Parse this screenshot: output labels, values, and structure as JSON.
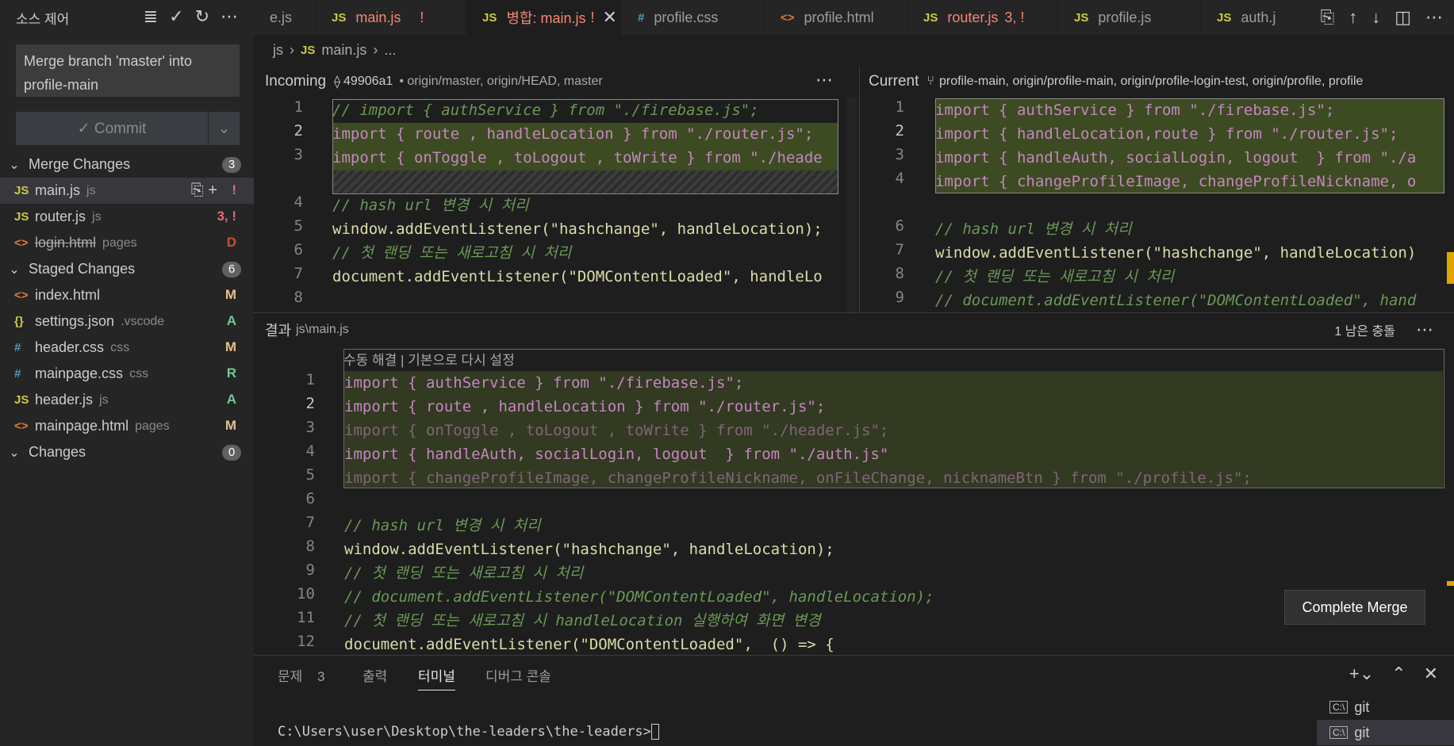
{
  "sidebar": {
    "title": "소스 제어",
    "commit_message": "Merge branch 'master' into profile-main",
    "commit_label": "✓ Commit",
    "merge_changes": {
      "label": "Merge Changes",
      "count": "3"
    },
    "staged_changes": {
      "label": "Staged Changes",
      "count": "6"
    },
    "changes": {
      "label": "Changes",
      "count": "0"
    },
    "merge_items": [
      {
        "icon": "JS",
        "name": "main.js",
        "dir": "js",
        "status": "!"
      },
      {
        "icon": "JS",
        "name": "router.js",
        "dir": "js",
        "status": "3, !"
      },
      {
        "icon": "<>",
        "name": "login.html",
        "dir": "pages",
        "status": "D"
      }
    ],
    "staged_items": [
      {
        "icon": "<>",
        "name": "index.html",
        "dir": "",
        "status": "M"
      },
      {
        "icon": "{}",
        "name": "settings.json",
        "dir": ".vscode",
        "status": "A"
      },
      {
        "icon": "#",
        "name": "header.css",
        "dir": "css",
        "status": "M"
      },
      {
        "icon": "#",
        "name": "mainpage.css",
        "dir": "css",
        "status": "R"
      },
      {
        "icon": "JS",
        "name": "header.js",
        "dir": "js",
        "status": "A"
      },
      {
        "icon": "<>",
        "name": "mainpage.html",
        "dir": "pages",
        "status": "M"
      }
    ]
  },
  "tabs": [
    {
      "icon": "",
      "name": "e.js",
      "badge": ""
    },
    {
      "icon": "JS",
      "name": "main.js",
      "badge": "!"
    },
    {
      "icon": "JS",
      "name": "병합: main.js",
      "badge": "!"
    },
    {
      "icon": "#",
      "name": "profile.css",
      "badge": ""
    },
    {
      "icon": "<>",
      "name": "profile.html",
      "badge": ""
    },
    {
      "icon": "JS",
      "name": "router.js",
      "badge": "3, !"
    },
    {
      "icon": "JS",
      "name": "profile.js",
      "badge": ""
    },
    {
      "icon": "JS",
      "name": "auth.j",
      "badge": ""
    }
  ],
  "breadcrumb": {
    "folder": "js",
    "file": "main.js",
    "more": "..."
  },
  "incoming": {
    "label": "Incoming",
    "commit": "49906a1",
    "refs": "• origin/master, origin/HEAD, master"
  },
  "current": {
    "label": "Current",
    "refs": "profile-main, origin/profile-main, origin/profile-login-test, origin/profile, profile"
  },
  "result": {
    "label": "결과",
    "path": "js\\main.js",
    "conflicts": "1 남은 충돌",
    "codelens": "수동 해결 | 기본으로 다시 설정"
  },
  "complete_merge": "Complete Merge",
  "panel": {
    "tabs": [
      "문제",
      "출력",
      "터미널",
      "디버그 콘솔"
    ],
    "problems_count": "3",
    "prompt": "C:\\Users\\user\\Desktop\\the-leaders\\the-leaders>",
    "terminals": [
      "git",
      "git"
    ]
  },
  "line_numbers": {
    "incoming": [
      "1",
      "2",
      "3",
      "",
      "4",
      "5",
      "6",
      "7",
      "8"
    ],
    "current": [
      "1",
      "2",
      "3",
      "4",
      "",
      "6",
      "7",
      "8",
      "9"
    ],
    "result": [
      "1",
      "2",
      "3",
      "4",
      "5",
      "6",
      "7",
      "8",
      "9",
      "10",
      "11",
      "12"
    ]
  },
  "code": {
    "incoming": [
      "// import { authService } from \"./firebase.js\";",
      "import { route , handleLocation } from \"./router.js\";",
      "import { onToggle , toLogout , toWrite } from \"./heade",
      "",
      "// hash url 변경 시 처리",
      "window.addEventListener(\"hashchange\", handleLocation);",
      "// 첫 랜딩 또는 새로고침 시 처리",
      "document.addEventListener(\"DOMContentLoaded\", handleLo"
    ],
    "current": [
      "import { authService } from \"./firebase.js\";",
      "import { handleLocation,route } from \"./router.js\";",
      "import { handleAuth, socialLogin, logout  } from \"./a",
      "import { changeProfileImage, changeProfileNickname, o",
      "",
      "// hash url 변경 시 처리",
      "window.addEventListener(\"hashchange\", handleLocation)",
      "// 첫 랜딩 또는 새로고침 시 처리",
      "// document.addEventListener(\"DOMContentLoaded\", hand"
    ],
    "result": [
      "import { authService } from \"./firebase.js\";",
      "import { route , handleLocation } from \"./router.js\";",
      "import { onToggle , toLogout , toWrite } from \"./header.js\";",
      "import { handleAuth, socialLogin, logout  } from \"./auth.js\"",
      "import { changeProfileImage, changeProfileNickname, onFileChange, nicknameBtn } from \"./profile.js\";",
      "",
      "// hash url 변경 시 처리",
      "window.addEventListener(\"hashchange\", handleLocation);",
      "// 첫 랜딩 또는 새로고침 시 처리",
      "// document.addEventListener(\"DOMContentLoaded\", handleLocation);",
      "// 첫 랜딩 또는 새로고침 시 handleLocation 실행하여 화면 변경",
      "document.addEventListener(\"DOMContentLoaded\",  () => {"
    ]
  },
  "colors": {
    "accent": "#0078d4",
    "modified": "#e2c08d",
    "deleted": "#c74e39",
    "added": "#73c991",
    "conflict": "#e06c75"
  }
}
